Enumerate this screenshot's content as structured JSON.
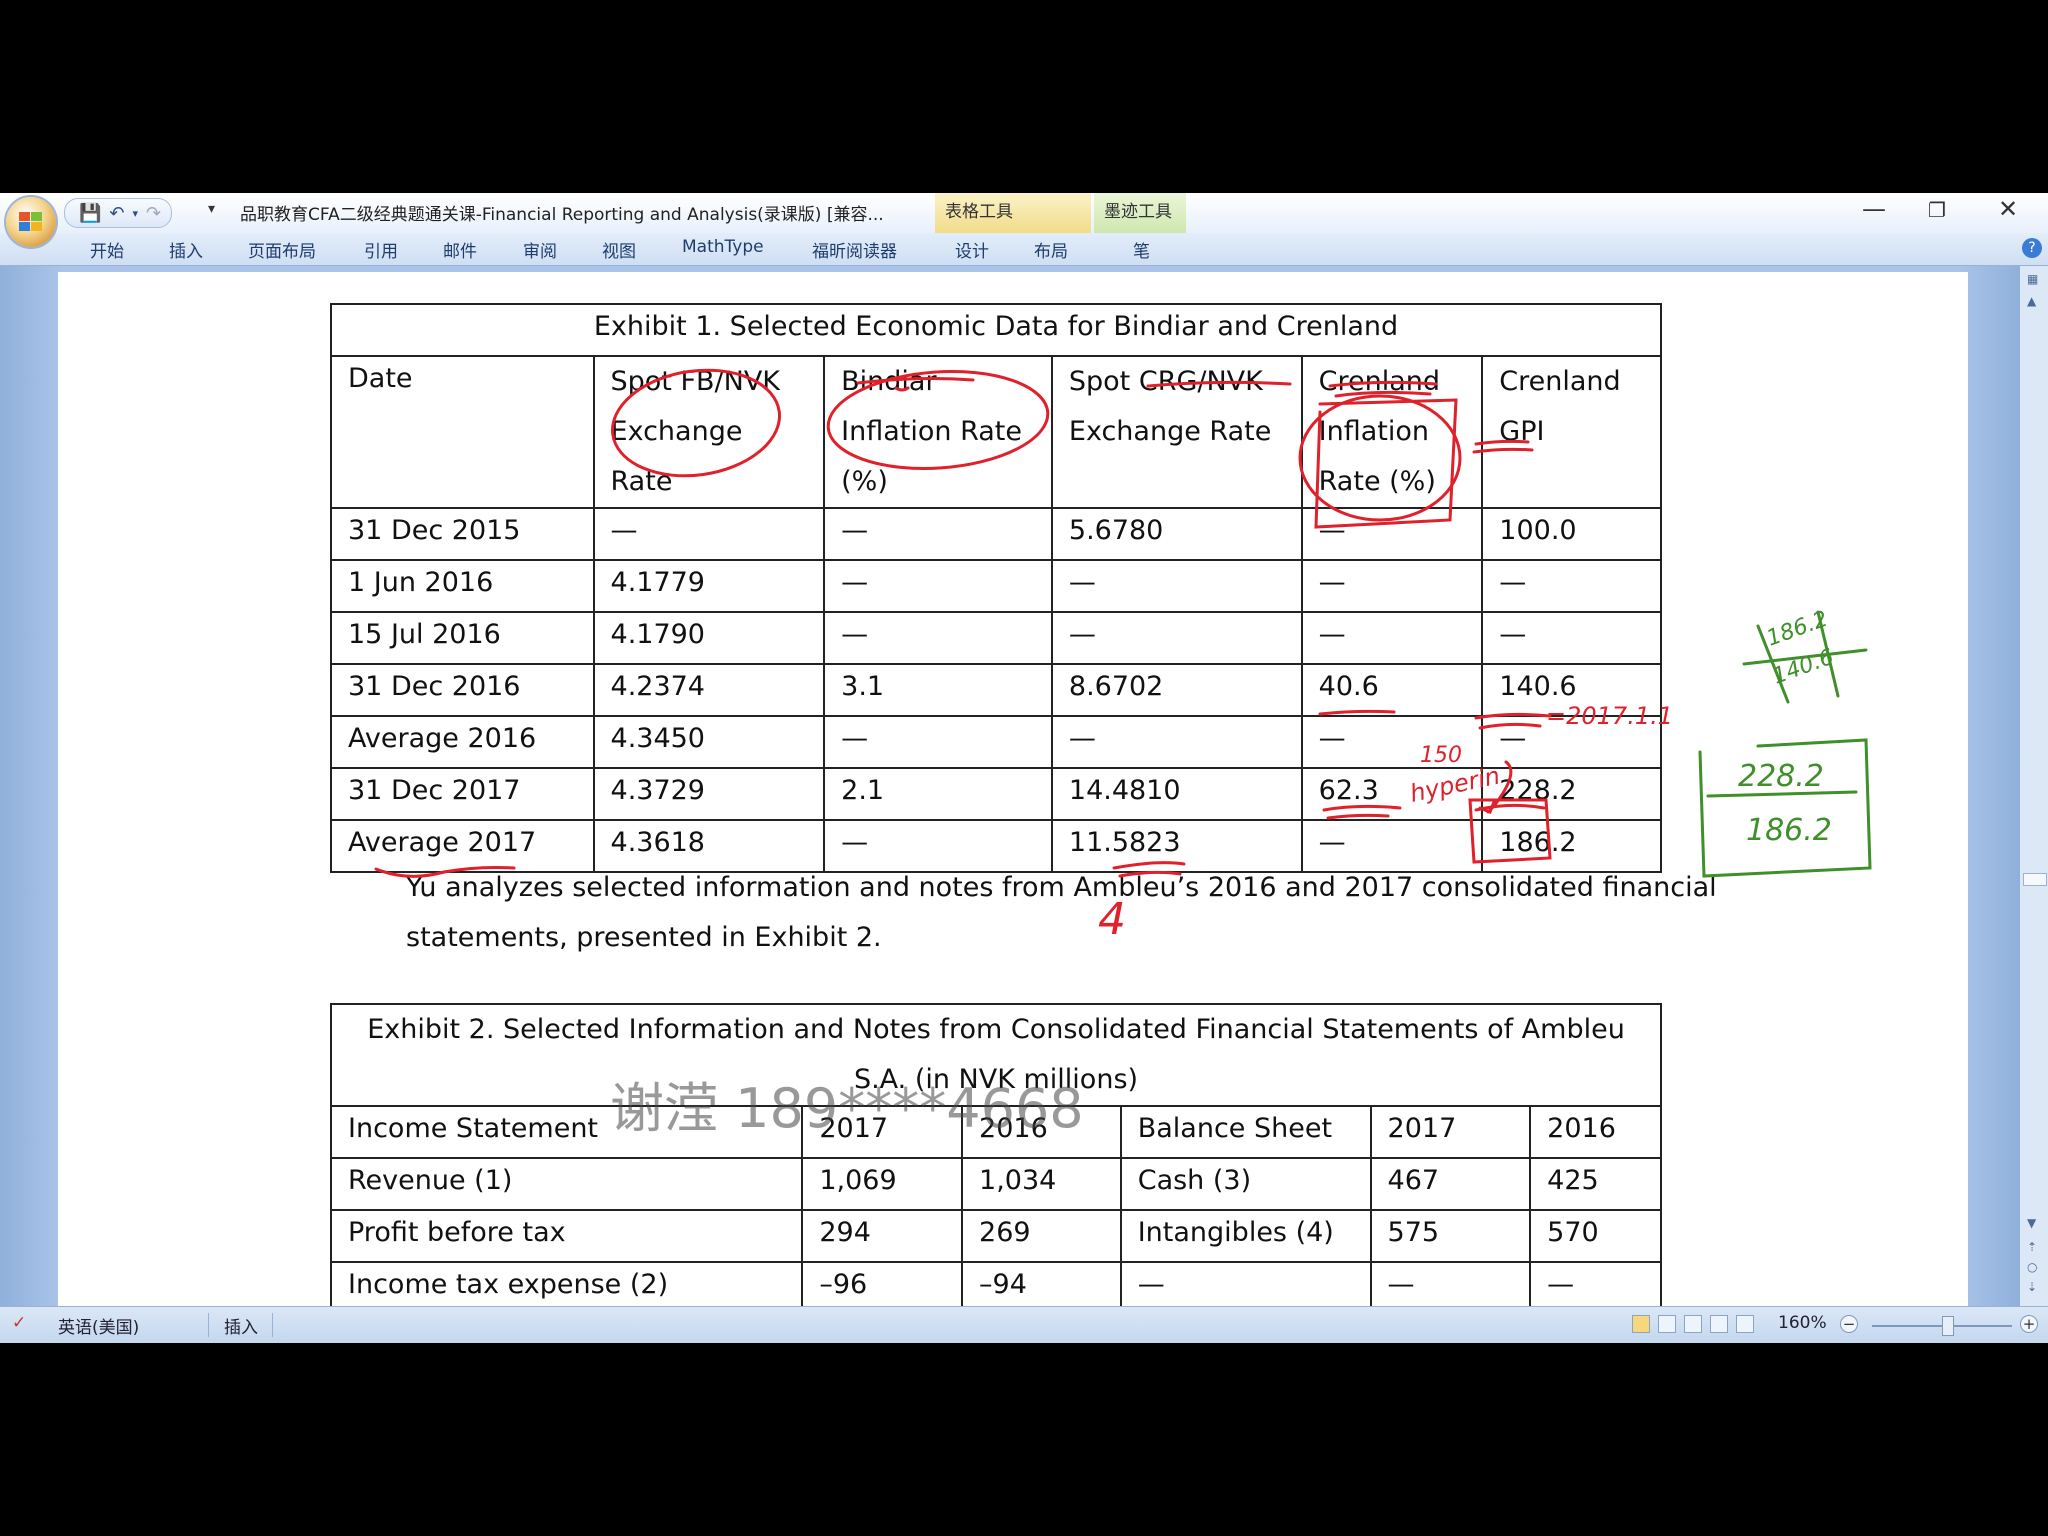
{
  "window": {
    "title": "品职教育CFA二级经典题通关课-Financial Reporting and Analysis(录课版) [兼容...",
    "context_tabs": [
      "表格工具",
      "墨迹工具"
    ],
    "controls": {
      "minimize": "—",
      "restore": "❐",
      "close": "✕"
    }
  },
  "ribbon": {
    "tabs": [
      "开始",
      "插入",
      "页面布局",
      "引用",
      "邮件",
      "审阅",
      "视图",
      "MathType",
      "福昕阅读器",
      "设计",
      "布局",
      "笔"
    ]
  },
  "exhibit1": {
    "caption": "Exhibit 1.    Selected Economic Data for Bindiar and Crenland",
    "headers": [
      [
        "Date"
      ],
      [
        "Spot FB/NVK",
        "Exchange",
        "Rate"
      ],
      [
        "Bindiar",
        "Inflation Rate",
        "(%)"
      ],
      [
        "Spot   CRG/NVK",
        "Exchange Rate"
      ],
      [
        "Crenland",
        "Inflation",
        "Rate (%)"
      ],
      [
        "Crenland",
        "GPI"
      ]
    ],
    "rows": [
      [
        "31 Dec 2015",
        "—",
        "—",
        "5.6780",
        "—",
        "100.0"
      ],
      [
        "1 Jun 2016",
        "4.1779",
        "—",
        "—",
        "—",
        "—"
      ],
      [
        "15 Jul 2016",
        "4.1790",
        "—",
        "—",
        "—",
        "—"
      ],
      [
        "31 Dec 2016",
        "4.2374",
        "3.1",
        "8.6702",
        "40.6",
        "140.6"
      ],
      [
        "Average 2016",
        "4.3450",
        "—",
        "—",
        "—",
        "—"
      ],
      [
        "31 Dec 2017",
        "4.3729",
        "2.1",
        "14.4810",
        "62.3",
        "228.2"
      ],
      [
        "Average 2017",
        "4.3618",
        "—",
        "11.5823",
        "—",
        "186.2"
      ]
    ]
  },
  "paragraph": {
    "line1": "Yu analyzes selected information and notes from Ambleu’s 2016 and 2017 consolidated financial",
    "line2": "statements, presented in Exhibit 2."
  },
  "exhibit2": {
    "caption_line1": "Exhibit 2. Selected Information and Notes from Consolidated Financial Statements of Ambleu",
    "caption_line2": "S.A. (in NVK millions)",
    "headers": [
      "Income Statement",
      "2017",
      "2016",
      "Balance Sheet",
      "2017",
      "2016"
    ],
    "rows": [
      [
        "Revenue (1)",
        "1,069",
        "1,034",
        "Cash (3)",
        "467",
        "425"
      ],
      [
        "Profit before tax",
        "294",
        "269",
        "Intangibles (4)",
        "575",
        "570"
      ],
      [
        "Income tax expense (2)",
        "–96",
        "–94",
        "—",
        "—",
        "—"
      ]
    ]
  },
  "watermark": "谢滢 189****4668",
  "annotations": {
    "note_date": "=2017.1.1",
    "note_150": "150",
    "note_hyper": "hyperin",
    "note_4": "4",
    "fraction_top": "228.2",
    "fraction_bottom": "186.2",
    "scribble_top": "186.2",
    "scribble_bottom": "140.6",
    "colors": {
      "red": "#e0202a",
      "green": "#3f8f2a"
    }
  },
  "statusbar": {
    "language": "英语(美国)",
    "mode": "插入",
    "zoom": "160%"
  }
}
